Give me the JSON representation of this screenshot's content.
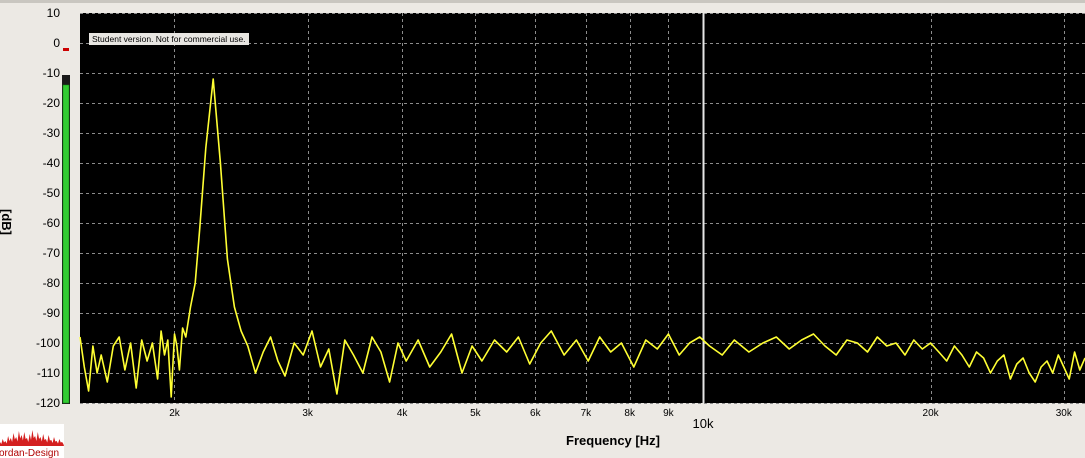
{
  "chart_data": {
    "type": "line",
    "title": "",
    "xlabel": "Frequency [Hz]",
    "ylabel": "[dB]",
    "xscale": "log",
    "xlim": [
      1500,
      32000
    ],
    "ylim": [
      -120,
      10
    ],
    "yticks": [
      10,
      0,
      -10,
      -20,
      -30,
      -40,
      -50,
      -60,
      -70,
      -80,
      -90,
      -100,
      -110,
      -120
    ],
    "xticks": [
      {
        "value": 2000,
        "label": "2k"
      },
      {
        "value": 3000,
        "label": "3k"
      },
      {
        "value": 4000,
        "label": "4k"
      },
      {
        "value": 5000,
        "label": "5k"
      },
      {
        "value": 6000,
        "label": "6k"
      },
      {
        "value": 7000,
        "label": "7k"
      },
      {
        "value": 8000,
        "label": "8k"
      },
      {
        "value": 9000,
        "label": "9k"
      },
      {
        "value": 10000,
        "label": "10k"
      },
      {
        "value": 20000,
        "label": "20k"
      },
      {
        "value": 30000,
        "label": "30k"
      }
    ],
    "grid": true,
    "background": "#000000",
    "series_color": "#ffff33",
    "cursor_x": 10000,
    "series": [
      {
        "x": [
          1500,
          1520,
          1540,
          1560,
          1580,
          1600,
          1630,
          1660,
          1690,
          1720,
          1750,
          1780,
          1810,
          1840,
          1870,
          1900,
          1920,
          1940,
          1960,
          1980,
          2000,
          2015,
          2030,
          2050,
          2070,
          2100,
          2130,
          2160,
          2200,
          2250,
          2300,
          2350,
          2400,
          2450,
          2500,
          2560,
          2620,
          2680,
          2740,
          2800,
          2880,
          2960,
          3040,
          3120,
          3200,
          3280,
          3360,
          3450,
          3550,
          3650,
          3750,
          3850,
          3950,
          4050,
          4200,
          4350,
          4500,
          4650,
          4800,
          4950,
          5100,
          5300,
          5500,
          5700,
          5900,
          6100,
          6300,
          6550,
          6800,
          7050,
          7300,
          7550,
          7800,
          8100,
          8400,
          8700,
          9000,
          9300,
          9600,
          9900,
          10200,
          10600,
          11000,
          11500,
          12000,
          12500,
          13000,
          13500,
          14000,
          14500,
          15000,
          15500,
          16000,
          16500,
          17000,
          17500,
          18000,
          18500,
          19000,
          19500,
          20000,
          20500,
          21000,
          21500,
          22000,
          22500,
          23000,
          23500,
          24000,
          24500,
          25000,
          25500,
          26000,
          26500,
          27000,
          27500,
          28000,
          28500,
          29000,
          29500,
          30000,
          30500,
          31000,
          31500,
          32000
        ],
        "y": [
          -98,
          -108,
          -116,
          -101,
          -110,
          -104,
          -113,
          -101,
          -98,
          -109,
          -100,
          -115,
          -99,
          -106,
          -100,
          -112,
          -96,
          -104,
          -99,
          -118,
          -97,
          -101,
          -109,
          -95,
          -98,
          -88,
          -80,
          -62,
          -35,
          -12,
          -40,
          -72,
          -88,
          -96,
          -101,
          -110,
          -103,
          -98,
          -106,
          -111,
          -100,
          -104,
          -96,
          -108,
          -102,
          -117,
          -99,
          -104,
          -110,
          -98,
          -103,
          -113,
          -100,
          -106,
          -99,
          -108,
          -103,
          -97,
          -110,
          -101,
          -106,
          -99,
          -103,
          -98,
          -107,
          -100,
          -96,
          -104,
          -99,
          -106,
          -98,
          -103,
          -100,
          -108,
          -99,
          -102,
          -97,
          -104,
          -100,
          -98,
          -101,
          -104,
          -99,
          -103,
          -100,
          -98,
          -102,
          -99,
          -97,
          -101,
          -104,
          -99,
          -100,
          -103,
          -98,
          -101,
          -100,
          -104,
          -99,
          -102,
          -100,
          -103,
          -106,
          -101,
          -104,
          -108,
          -103,
          -105,
          -110,
          -106,
          -104,
          -112,
          -107,
          -105,
          -110,
          -113,
          -108,
          -106,
          -110,
          -104,
          -108,
          -112,
          -103,
          -109,
          -105
        ]
      }
    ],
    "watermark": "Student version. Not for commercial use.",
    "level_meter": {
      "value_db": -12,
      "color": "#33cc33",
      "peak_color": "#cc0000"
    },
    "logo_text": "Jordan-Design"
  }
}
